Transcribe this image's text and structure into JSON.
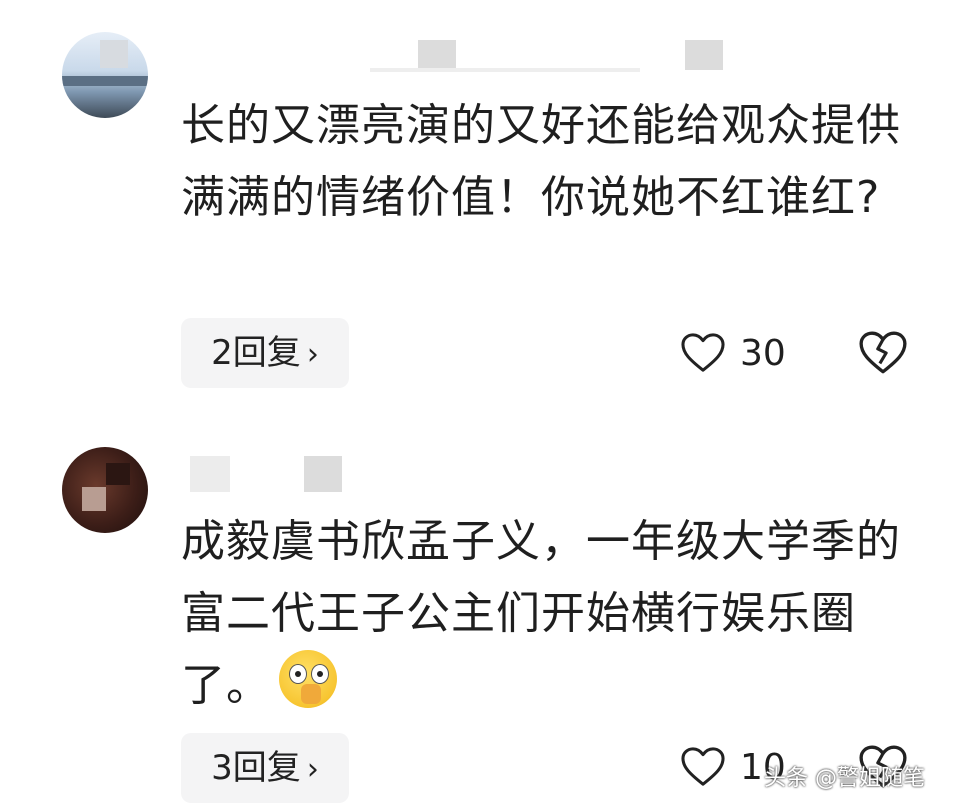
{
  "comments": [
    {
      "text": "长的又漂亮演的又好还能给观众提供满满的情绪价值！你说她不红谁红?",
      "reply_label": "2回复",
      "likes": "30"
    },
    {
      "text": "成毅虞书欣孟子义，一年级大学季的富二代王子公主们开始横行娱乐圈了。",
      "reply_label": "3回复",
      "likes": "10"
    }
  ],
  "icons": {
    "reply_chevron": "chevron-right-icon",
    "like": "heart-outline-icon",
    "dislike": "broken-heart-icon",
    "emoji": "flushed-hand-over-mouth-emoji"
  },
  "watermark": "头条 @警姐随笔",
  "colors": {
    "background": "#ffffff",
    "text": "#1f1f1f",
    "reply_bg": "#f4f4f5"
  }
}
